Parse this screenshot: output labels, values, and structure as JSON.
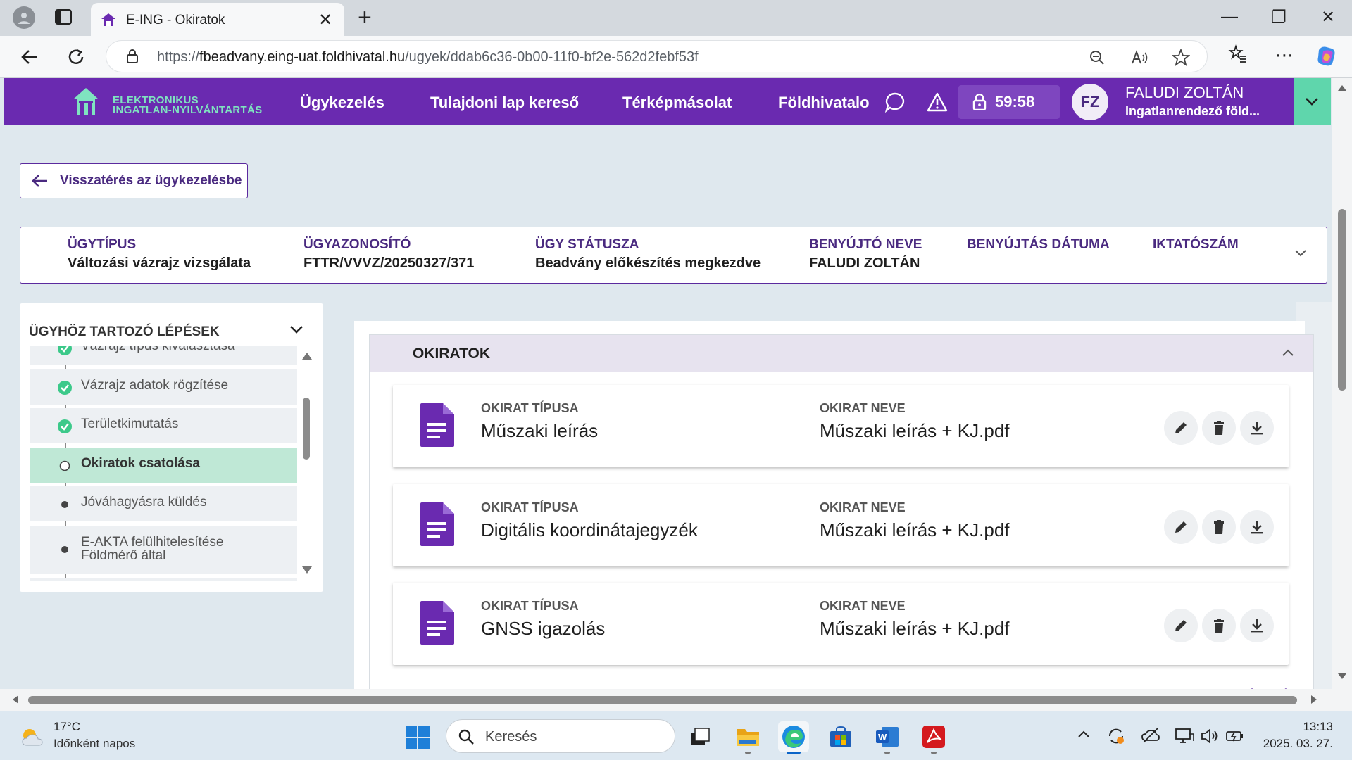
{
  "browser": {
    "tab_title": "E-ING - Okiratok",
    "url_scheme": "https://",
    "url_host": "fbeadvany.eing-uat.foldhivatal.hu",
    "url_path": "/ugyek/ddab6c36-0b00-11f0-bf2e-562d2febf53f"
  },
  "app": {
    "logo_line1": "ELEKTRONIKUS",
    "logo_line2": "INGATLAN-NYILVÁNTARTÁS",
    "menu": [
      "Ügykezelés",
      "Tulajdoni lap kereső",
      "Térképmásolat",
      "Földhivatalo"
    ],
    "timer": "59:58",
    "user_initials": "FZ",
    "user_name": "FALUDI ZOLTÁN",
    "user_org": "Ingatlanrendező föld..."
  },
  "page": {
    "back_label": "Visszatérés az ügykezelésbe"
  },
  "case": {
    "fields": [
      {
        "label": "ÜGYTÍPUS",
        "value": "Változási vázrajz vizsgálata"
      },
      {
        "label": "ÜGYAZONOSÍTÓ",
        "value": "FTTR/VVVZ/20250327/371"
      },
      {
        "label": "ÜGY STÁTUSZA",
        "value": "Beadvány előkészítés megkezdve"
      },
      {
        "label": "BENYÚJTÓ NEVE",
        "value": "FALUDI ZOLTÁN"
      },
      {
        "label": "BENYÚJTÁS DÁTUMA",
        "value": ""
      },
      {
        "label": "IKTATÓSZÁM",
        "value": ""
      }
    ]
  },
  "steps": {
    "title": "ÜGYHÖZ TARTOZÓ LÉPÉSEK",
    "items": [
      {
        "label": "Vázrajz típus kiválasztása",
        "state": "done"
      },
      {
        "label": "Vázrajz adatok rögzítése",
        "state": "done"
      },
      {
        "label": "Területkimutatás",
        "state": "done"
      },
      {
        "label": "Okiratok csatolása",
        "state": "current"
      },
      {
        "label": "Jóváhagyásra küldés",
        "state": "pending"
      },
      {
        "label": "E-AKTA felülhitelesítése",
        "label2": "Földmérő által",
        "state": "pending"
      }
    ]
  },
  "documents": {
    "title": "OKIRATOK",
    "type_label": "OKIRAT TÍPUSA",
    "name_label": "OKIRAT NEVE",
    "items": [
      {
        "type": "Műszaki leírás",
        "name": "Műszaki leírás + KJ.pdf"
      },
      {
        "type": "Digitális koordinátajegyzék",
        "name": "Műszaki leírás + KJ.pdf"
      },
      {
        "type": "GNSS igazolás",
        "name": "Műszaki leírás + KJ.pdf"
      }
    ]
  },
  "taskbar": {
    "weather_temp": "17°C",
    "weather_desc": "Időnként napos",
    "search_placeholder": "Keresés",
    "time": "13:13",
    "date": "2025. 03. 27."
  },
  "colors": {
    "brand_purple": "#6a2ab0",
    "accent_green": "#5fd6ac",
    "active_step": "#bfe8d6",
    "check_green": "#3cc98a"
  }
}
